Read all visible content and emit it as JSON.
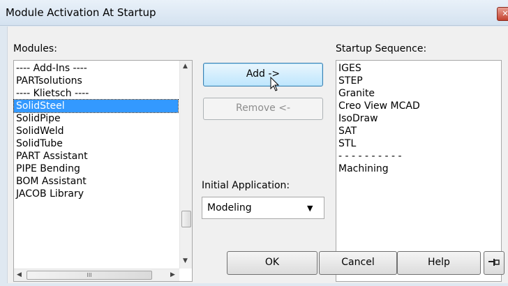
{
  "window": {
    "title": "Module Activation At Startup",
    "close_glyph": "✕"
  },
  "modules": {
    "label": "Modules:",
    "items": [
      "---- Add-Ins ----",
      "PARTsolutions",
      "---- Klietsch ----",
      "SolidSteel",
      "SolidPipe",
      "SolidWeld",
      "SolidTube",
      "PART Assistant",
      "PIPE Bending",
      "BOM Assistant",
      "JACOB Library"
    ],
    "selected": "SolidSteel",
    "hscroll_grip": "III"
  },
  "buttons": {
    "add": "Add ->",
    "remove": "Remove <-",
    "ok": "OK",
    "cancel": "Cancel",
    "help": "Help",
    "pin_icon": "pushpin-icon"
  },
  "initial_application": {
    "label": "Initial Application:",
    "value": "Modeling"
  },
  "startup_sequence": {
    "label": "Startup Sequence:",
    "items": [
      "IGES",
      "STEP",
      "Granite",
      "Creo View MCAD",
      "IsoDraw",
      "SAT",
      "STL",
      "- - - - - - - - - -",
      "Machining"
    ]
  },
  "colors": {
    "selection": "#3399ff",
    "dialog_bg": "#f0f0f0",
    "titlebar": "#dfe8f1"
  }
}
